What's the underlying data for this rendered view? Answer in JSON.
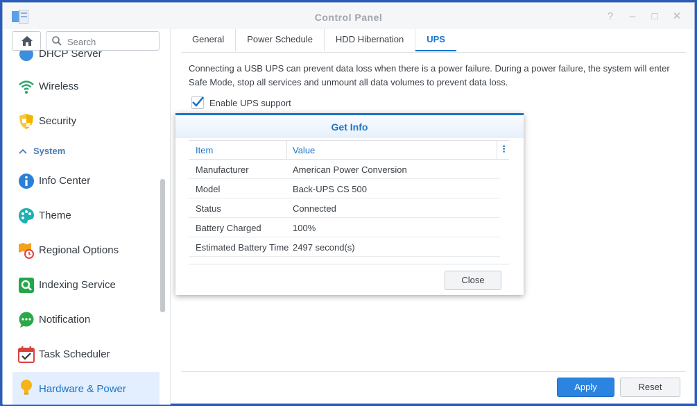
{
  "window": {
    "title": "Control Panel"
  },
  "sidebar": {
    "search_placeholder": "Search",
    "items_top": [
      {
        "label": "DHCP Server",
        "icon": "dhcp-icon"
      },
      {
        "label": "Wireless",
        "icon": "wireless-icon"
      },
      {
        "label": "Security",
        "icon": "shield-icon"
      }
    ],
    "group": {
      "label": "System"
    },
    "items": [
      {
        "label": "Info Center",
        "icon": "info-icon"
      },
      {
        "label": "Theme",
        "icon": "palette-icon"
      },
      {
        "label": "Regional Options",
        "icon": "map-clock-icon"
      },
      {
        "label": "Indexing Service",
        "icon": "index-search-icon"
      },
      {
        "label": "Notification",
        "icon": "chat-bubble-icon"
      },
      {
        "label": "Task Scheduler",
        "icon": "calendar-check-icon"
      },
      {
        "label": "Hardware & Power",
        "icon": "bulb-icon"
      }
    ]
  },
  "tabs": [
    "General",
    "Power Schedule",
    "HDD Hibernation",
    "UPS"
  ],
  "active_tab": "UPS",
  "ups": {
    "description": "Connecting a USB UPS can prevent data loss when there is a power failure. During a power failure, the system will enter Safe Mode, stop all services and unmount all data volumes to prevent data loss.",
    "enable_label": "Enable UPS support",
    "enabled": true
  },
  "dialog": {
    "title": "Get Info",
    "columns": [
      "Item",
      "Value"
    ],
    "rows": [
      {
        "item": "Manufacturer",
        "value": "American Power Conversion"
      },
      {
        "item": "Model",
        "value": "Back-UPS CS 500"
      },
      {
        "item": "Status",
        "value": "Connected"
      },
      {
        "item": "Battery Charged",
        "value": "100%"
      },
      {
        "item": "Estimated Battery Time",
        "value": "2497 second(s)"
      }
    ],
    "close_label": "Close"
  },
  "footer": {
    "apply_label": "Apply",
    "reset_label": "Reset"
  },
  "colors": {
    "accent": "#1a74c9",
    "apply_bg": "#2a84e0",
    "desktop": "#2b5db8"
  }
}
